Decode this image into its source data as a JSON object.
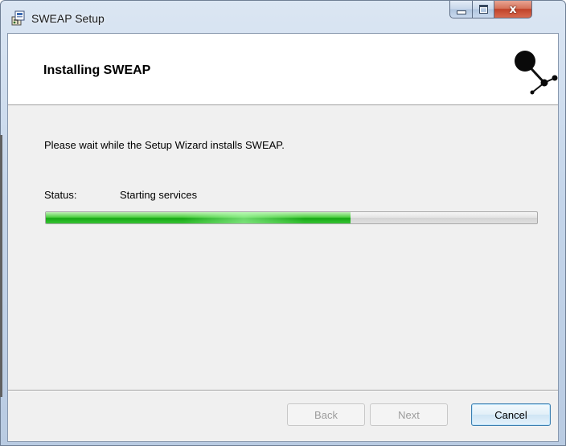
{
  "window": {
    "title": "SWEAP Setup",
    "app_icon": "installer-icon"
  },
  "controls": {
    "minimize_icon": "minimize-icon",
    "maximize_icon": "maximize-icon",
    "close_icon": "close-icon",
    "close_glyph": "x"
  },
  "header": {
    "title": "Installing SWEAP",
    "logo_icon": "network-node-logo"
  },
  "body": {
    "intro": "Please wait while the Setup Wizard installs SWEAP.",
    "status_label": "Status:",
    "status_value": "Starting services",
    "progress_fraction": 0.62
  },
  "buttons": {
    "back": "Back",
    "next": "Next",
    "cancel": "Cancel"
  },
  "colors": {
    "progress_green": "#17a816",
    "close_red": "#c0432a",
    "dialog_bg": "#f0f0f0",
    "disabled_text": "#9c9c9c"
  }
}
